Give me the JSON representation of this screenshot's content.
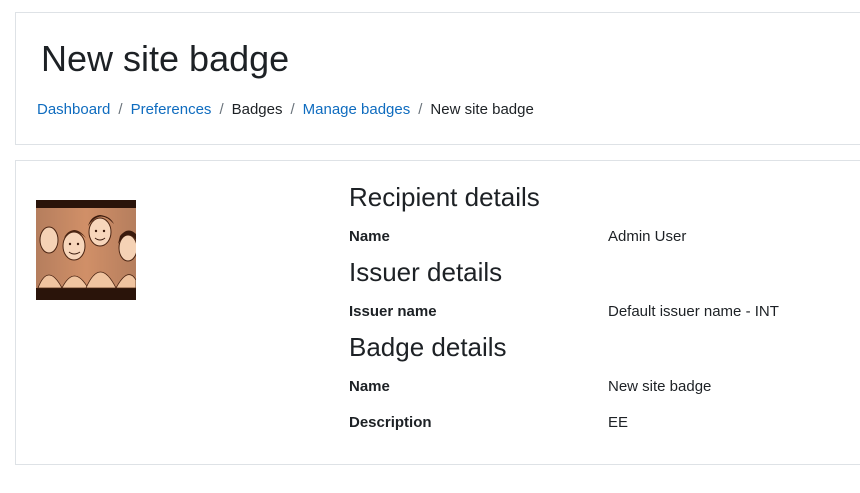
{
  "header": {
    "title": "New site badge",
    "breadcrumb": [
      {
        "label": "Dashboard",
        "link": true
      },
      {
        "label": "Preferences",
        "link": true
      },
      {
        "label": "Badges",
        "link": false
      },
      {
        "label": "Manage badges",
        "link": true
      },
      {
        "label": "New site badge",
        "link": false
      }
    ],
    "separator": "/"
  },
  "badge": {
    "recipient": {
      "heading": "Recipient details",
      "name_label": "Name",
      "name_value": "Admin User"
    },
    "issuer": {
      "heading": "Issuer details",
      "issuer_name_label": "Issuer name",
      "issuer_name_value": "Default issuer name - INT"
    },
    "details": {
      "heading": "Badge details",
      "name_label": "Name",
      "name_value": "New site badge",
      "description_label": "Description",
      "description_value": "EE"
    }
  },
  "colors": {
    "link": "#0f6cbf",
    "text": "#1d2125",
    "border": "#dee2e6"
  }
}
